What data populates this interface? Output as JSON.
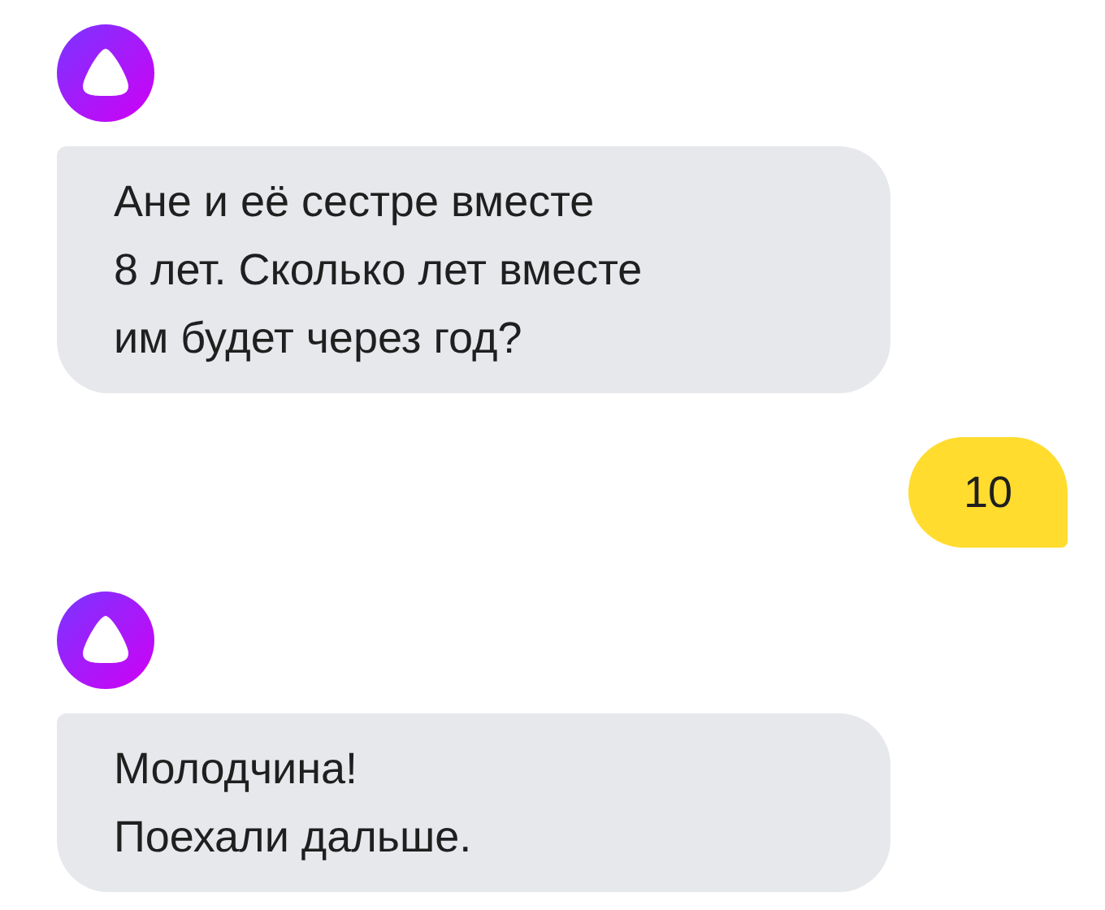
{
  "messages": [
    {
      "kind": "bot",
      "text": "Ане и её сестре вместе\n8 лет. Сколько лет вместе\nим будет через год?"
    },
    {
      "kind": "user",
      "text": "10"
    },
    {
      "kind": "bot",
      "text": "Молодчина!\nПоехали дальше."
    }
  ]
}
